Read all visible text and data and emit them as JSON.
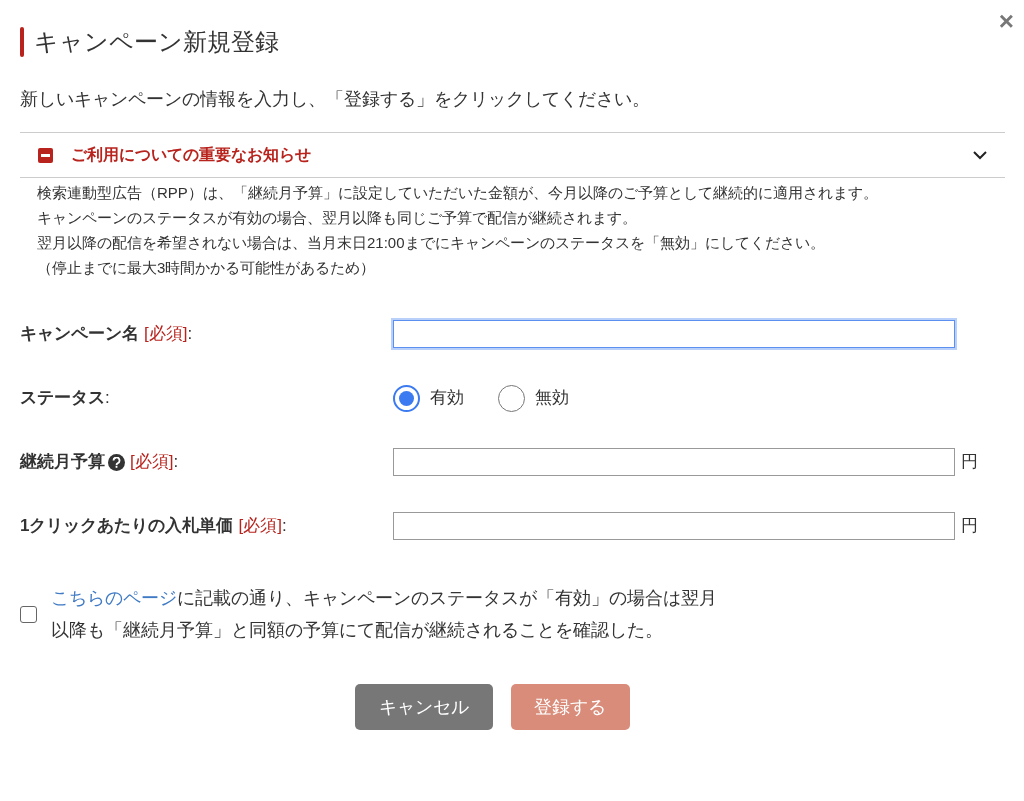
{
  "dialog": {
    "title": "キャンペーン新規登録",
    "close": "×",
    "description": "新しいキャンペーンの情報を入力し、「登録する」をクリックしてください。"
  },
  "notice": {
    "title": "ご利用についての重要なお知らせ",
    "expanded": true,
    "lines": [
      "検索連動型広告（RPP）は、「継続月予算」に設定していただいた金額が、今月以降のご予算として継続的に適用されます。",
      "キャンペーンのステータスが有効の場合、翌月以降も同じご予算で配信が継続されます。",
      "翌月以降の配信を希望されない場合は、当月末日21:00までにキャンペーンのステータスを「無効」にしてください。",
      "（停止までに最大3時間かかる可能性があるため）"
    ]
  },
  "form": [
    {
      "kind": "text",
      "label": "キャンペーン名",
      "help": false,
      "required": "[必須]",
      "colon": ":",
      "focused": true
    },
    {
      "kind": "radio",
      "label": "ステータス",
      "help": false,
      "colon": ":",
      "options": [
        {
          "label": "有効",
          "selected": true
        },
        {
          "label": "無効",
          "selected": false
        }
      ]
    },
    {
      "kind": "money",
      "label": "継続月予算",
      "help": true,
      "required": "[必須]",
      "colon": ":",
      "focused": false,
      "unit": "円"
    },
    {
      "kind": "money",
      "label": "1クリックあたりの入札単価",
      "help": false,
      "required": "[必須]",
      "colon": ":",
      "focused": false,
      "unit": "円"
    }
  ],
  "confirm": {
    "checked": false,
    "link": "こちらのページ",
    "text": "に記載の通り、キャンペーンのステータスが「有効」の場合は翌月以降も「継続月予算」と同額の予算にて配信が継続されることを確認した。"
  },
  "buttons": [
    {
      "kind": "cancel",
      "label": "キャンセル",
      "disabled": false
    },
    {
      "kind": "submit",
      "label": "登録する",
      "disabled": true
    }
  ]
}
